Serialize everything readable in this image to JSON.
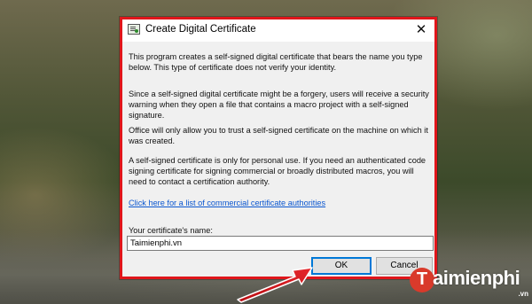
{
  "window": {
    "title": "Create Digital Certificate",
    "close_glyph": "✕",
    "highlight_color": "#e0161b"
  },
  "content": {
    "paragraph1": "This program creates a self-signed digital certificate that bears the name you type below. This type of certificate does not verify your identity.",
    "paragraph2": "Since a self-signed digital certificate might be a forgery, users will receive a security warning when they open a file that contains a macro project with a self-signed signature.",
    "paragraph3": "Office will only allow you to trust a self-signed certificate on the machine on which it was created.",
    "paragraph4": "A self-signed certificate is only for personal use. If you need an authenticated code signing certificate for signing commercial or broadly distributed macros, you will need to contact a certification authority.",
    "link_text": "Click here for a list of commercial certificate authorities",
    "name_label": "Your certificate's name:",
    "name_value": "Taimienphi.vn"
  },
  "buttons": {
    "ok_label": "OK",
    "cancel_label": "Cancel"
  },
  "watermark": {
    "initial": "T",
    "name": "aimienphi",
    "tld": ".vn"
  },
  "colors": {
    "accent_red": "#e0161b",
    "focus_blue": "#0078d7",
    "link_blue": "#0b57d0"
  }
}
